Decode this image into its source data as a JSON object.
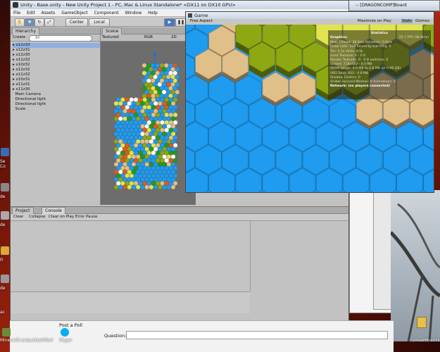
{
  "window": {
    "title": "Unity - Base.unity - New Unity Project 1 - PC, Mac & Linux Standalone* <DX11 on DX10 GPU>"
  },
  "menu": [
    "File",
    "Edit",
    "Assets",
    "GameObject",
    "Component",
    "Window",
    "Help"
  ],
  "toolbar": {
    "center_label": "Center",
    "local_label": "Local"
  },
  "hierarchy": {
    "tab_label": "Hierarchy",
    "create_label": "Create",
    "search_placeholder": "All",
    "items": [
      "x12z33",
      "x12z31",
      "x12z30",
      "x11z32",
      "x10z32",
      "x12z32",
      "x11z32",
      "x10z31",
      "x11z31",
      "x11z30",
      "Main Camera",
      "Directional light",
      "Directional light",
      "Scale"
    ]
  },
  "scene": {
    "tab_label": "Scene",
    "shading_label": "Textured",
    "rgb_label": "RGB",
    "mode_2d": "2D"
  },
  "game": {
    "tab_label": "Game",
    "aspect_label": "Free Aspect",
    "maximize_label": "Maximize on Play",
    "stats_label": "Stats",
    "gizmos_label": "Gizmos",
    "stats_panel": {
      "title": "Statistics",
      "graphics_label": "Graphics:",
      "fps": "25.7 FPS (38.9ms)",
      "lines": [
        "Main Thread: 38.9ms   Renderer: 0.0ms",
        "Draw Calls: 319   Saved by batching: 0",
        "Tris: 5.1k     Verts: 8.5k",
        "Used Textures: 0 - 0 B",
        "Render Textures: 0 - 0 B   switches: 0",
        "Screen: 718x483 - 4.0 MB",
        "VRAM usage: 4.0 MB to 4.8 MB (of 0.99 GB)",
        "VBO Total: 403 - 0.8 MB",
        "Shadow Casters: 0",
        "Visible Skinned Meshes: 0     Animations: 0"
      ],
      "network": "Network: (no players connected)"
    }
  },
  "console": {
    "project_tab": "Project",
    "console_tab": "Console",
    "buttons": [
      "Clear",
      "Collapse",
      "Clear on Play",
      "Error Pause"
    ]
  },
  "background_window": {
    "title": "-- [DRAGONCOMP]Board"
  },
  "forum": {
    "post_label": "Post a Poll",
    "question_label": "Question:"
  },
  "desktop": {
    "icons": [
      "Se",
      "Co",
      "de",
      "de",
      "Fi",
      "de",
      "ac"
    ],
    "taskbar": [
      "Minecraft.exe",
      "LuHasMTool",
      "Skype"
    ],
    "right_icon": "UnusHbud.txt"
  },
  "colors": {
    "water": "#1f9bef",
    "grass": "#8ea813",
    "sand": "#e1bf88",
    "dirt": "#e25a1c",
    "forest": "#219b20",
    "meadow": "#e1e44e"
  }
}
